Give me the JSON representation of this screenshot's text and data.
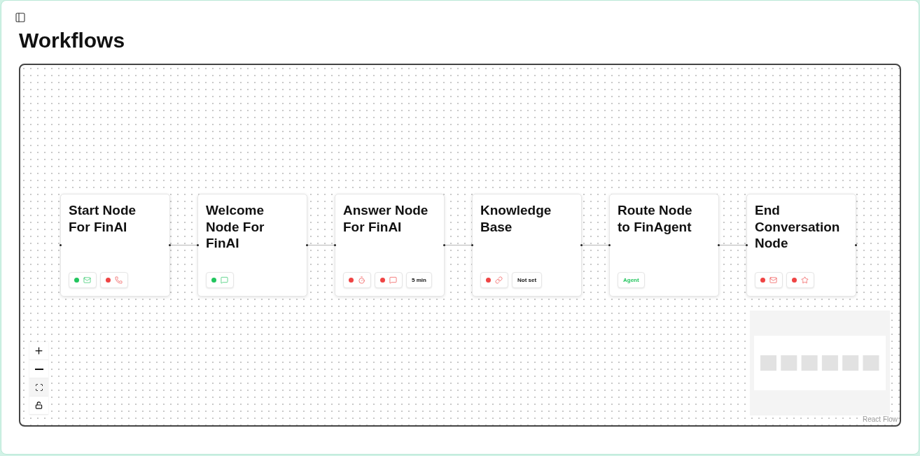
{
  "page": {
    "title": "Workflows"
  },
  "nodes": [
    {
      "title": "Start Node For FinAI",
      "badges": [
        {
          "kind": "mail",
          "color": "#22c55e"
        },
        {
          "kind": "phone",
          "color": "#ef4444"
        }
      ]
    },
    {
      "title": "Welcome Node For FinAI",
      "badges": [
        {
          "kind": "message",
          "color": "#22c55e"
        }
      ]
    },
    {
      "title": "Answer Node For FinAI",
      "badges": [
        {
          "kind": "timer",
          "color": "#ef4444"
        },
        {
          "kind": "message",
          "color": "#ef4444"
        },
        {
          "kind": "text",
          "label": "5 min"
        }
      ]
    },
    {
      "title": "Knowledge Base",
      "badges": [
        {
          "kind": "link",
          "color": "#ef4444"
        },
        {
          "kind": "text",
          "label": "Not set"
        }
      ]
    },
    {
      "title": "Route Node to FinAgent",
      "badges": [
        {
          "kind": "text",
          "label": "Agent",
          "color": "#22c55e"
        }
      ]
    },
    {
      "title": "End Conversation Node",
      "badges": [
        {
          "kind": "mail",
          "color": "#ef4444"
        },
        {
          "kind": "star",
          "color": "#ef4444"
        }
      ]
    }
  ],
  "attribution": "React Flow"
}
